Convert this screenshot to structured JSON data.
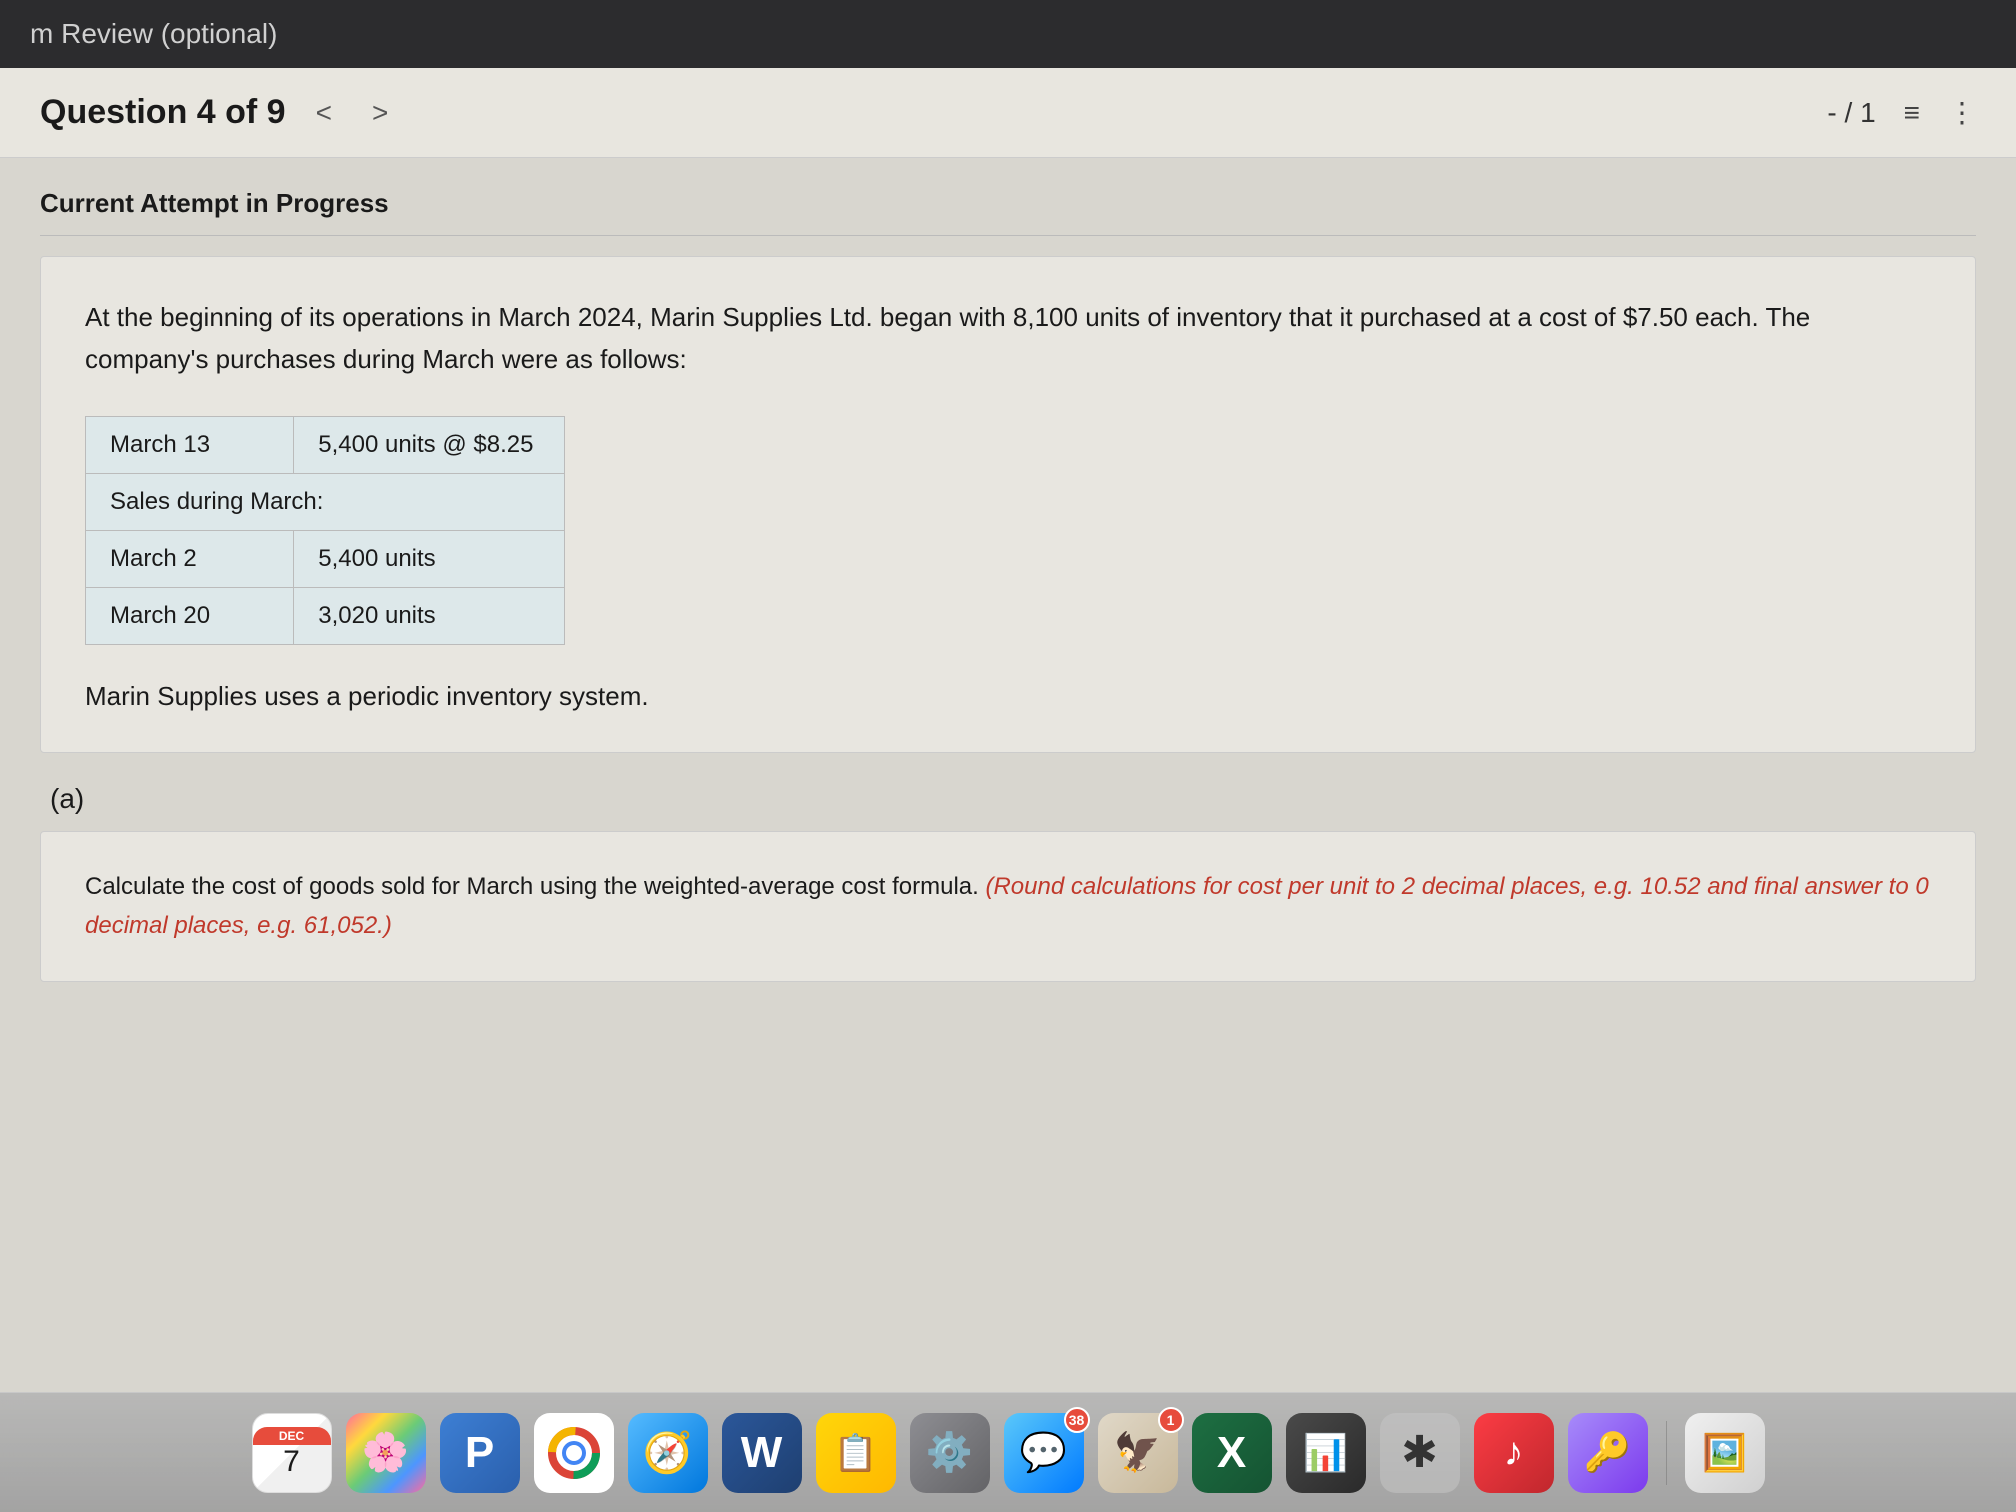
{
  "topbar": {
    "title": "m Review (optional)"
  },
  "header": {
    "question_label": "Question 4 of 9",
    "nav_prev": "<",
    "nav_next": ">",
    "score": "- / 1",
    "list_icon": "≡",
    "dots_icon": "⋮"
  },
  "attempt": {
    "label": "Current Attempt in Progress"
  },
  "question": {
    "text": "At the beginning of its operations in March 2024, Marin Supplies Ltd. began with 8,100 units of inventory that it purchased at a cost of $7.50 each. The company's purchases during March were as follows:",
    "table": [
      {
        "date": "March 13",
        "amount": "5,400 units @ $8.25"
      },
      {
        "date": "Sales during March:",
        "amount": ""
      },
      {
        "date": "March 2",
        "amount": "5,400 units"
      },
      {
        "date": "March 20",
        "amount": "3,020 units"
      }
    ],
    "footer_text": "Marin Supplies uses a periodic inventory system."
  },
  "part_a": {
    "label": "(a)",
    "instruction_normal": "Calculate the cost of goods sold for March using the weighted-average cost formula.",
    "instruction_italic": "(Round calculations for cost per unit to 2 decimal places, e.g. 10.52 and final answer to 0 decimal places, e.g. 61,052.)"
  },
  "dock": {
    "calendar_month": "DEC",
    "calendar_day": "7",
    "badge_messages": "38",
    "badge_one": "1"
  }
}
